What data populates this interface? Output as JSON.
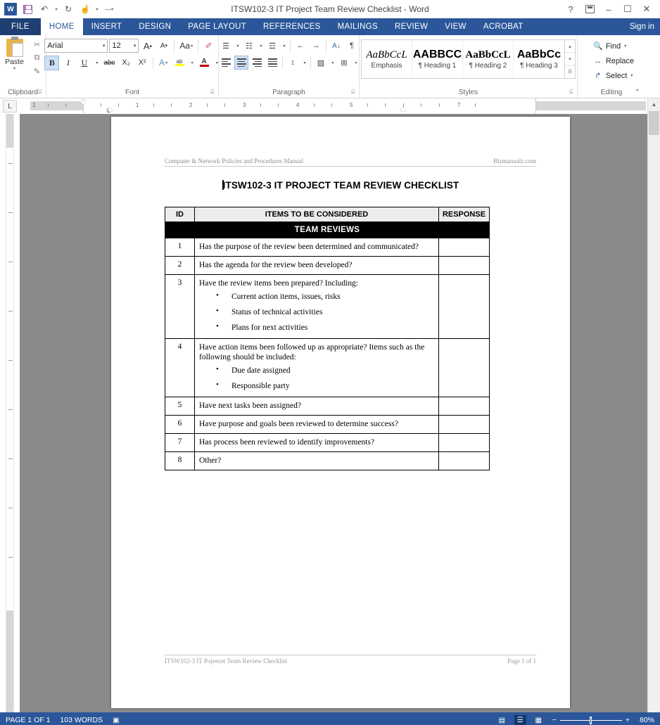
{
  "titlebar": {
    "app_icon": "word-logo",
    "document_title": "ITSW102-3 IT Project Team Review Checklist - Word",
    "quick_access": [
      {
        "name": "save",
        "glyph": "save-icon"
      },
      {
        "name": "undo",
        "glyph": "↶"
      },
      {
        "name": "redo",
        "glyph": "↻"
      },
      {
        "name": "touch-mode",
        "glyph": "☝"
      },
      {
        "name": "customize-qat",
        "glyph": "¯"
      }
    ],
    "help_label": "?",
    "ribbon_display_label": "",
    "minimize_label": "–",
    "maximize_label": "☐",
    "close_label": "✕",
    "word_mark": "W"
  },
  "tabs": {
    "file_label": "FILE",
    "items": [
      {
        "label": "HOME",
        "active": true
      },
      {
        "label": "INSERT",
        "active": false
      },
      {
        "label": "DESIGN",
        "active": false
      },
      {
        "label": "PAGE LAYOUT",
        "active": false
      },
      {
        "label": "REFERENCES",
        "active": false
      },
      {
        "label": "MAILINGS",
        "active": false
      },
      {
        "label": "REVIEW",
        "active": false
      },
      {
        "label": "VIEW",
        "active": false
      },
      {
        "label": "ACROBAT",
        "active": false
      }
    ],
    "signin_label": "Sign in"
  },
  "ribbon": {
    "clipboard": {
      "group_label": "Clipboard",
      "paste_label": "Paste",
      "paste_caret": "▾",
      "cut_label": "✂",
      "copy_label": "⧉",
      "format_painter_label": "✎"
    },
    "font": {
      "group_label": "Font",
      "font_name": "Arial",
      "font_size": "12",
      "grow_font": "A",
      "shrink_font": "A",
      "change_case": "Aa",
      "clear_formatting": "✐",
      "bold": "B",
      "italic": "I",
      "underline": "U",
      "strikethrough": "abc",
      "subscript": "X₂",
      "superscript": "X²",
      "text_effects": "A",
      "highlight": "ab",
      "font_color": "A",
      "font_color_hex": "#c00000",
      "highlight_color_hex": "#ffff00",
      "bold_active": true
    },
    "paragraph": {
      "group_label": "Paragraph",
      "bullets": "☰",
      "numbering": "☷",
      "multilevel": "☲",
      "decrease_indent": "←",
      "increase_indent": "→",
      "sort": "A↓",
      "show_marks": "¶",
      "align_left": "align-left",
      "align_center": "align-center",
      "align_right": "align-right",
      "justify": "justify",
      "line_spacing": "↕",
      "shading": "▧",
      "borders": "⊞",
      "center_active": true
    },
    "styles": {
      "group_label": "Styles",
      "items": [
        {
          "preview": "AaBbCcL",
          "name": "Emphasis",
          "mark": ""
        },
        {
          "preview": "AABBCC",
          "name": "Heading 1",
          "mark": "¶"
        },
        {
          "preview": "AaBbCcL",
          "name": "Heading 2",
          "mark": "¶"
        },
        {
          "preview": "AaBbCc",
          "name": "Heading 3",
          "mark": "¶"
        }
      ],
      "scroll_up": "▴",
      "scroll_down": "▾",
      "more": "☰"
    },
    "editing": {
      "group_label": "Editing",
      "find_label": "Find",
      "find_caret": "▾",
      "replace_label": "Replace",
      "select_label": "Select",
      "select_caret": "▾",
      "find_icon": "🔍",
      "replace_icon": "↔",
      "select_icon": "↱",
      "collapse_icon": "⌃"
    },
    "dialog_launcher": "⌸"
  },
  "ruler": {
    "tab_selector": "L",
    "horizontal_marks": [
      "1",
      "2",
      "3",
      "4",
      "5",
      "7"
    ],
    "unit": "inch"
  },
  "document": {
    "header_left": "Computer & Network Policies and Procedures Manual",
    "header_right": "Bizmanualz.com",
    "title": "ITSW102-3   IT PROJECT TEAM REVIEW CHECKLIST",
    "footer_left": "ITSW102-3 IT Pojeecet Team Review Checklist",
    "footer_right": "Page 1 of 1",
    "table": {
      "columns": [
        "ID",
        "ITEMS TO BE CONSIDERED",
        "RESPONSE"
      ],
      "section_band": "TEAM REVIEWS",
      "rows": [
        {
          "id": "1",
          "text": "Has the purpose of the review been determined and communicated?",
          "bullets": [],
          "response": ""
        },
        {
          "id": "2",
          "text": "Has the agenda for the review been developed?",
          "bullets": [],
          "response": ""
        },
        {
          "id": "3",
          "text": "Have the review items been prepared?  Including:",
          "bullets": [
            "Current action items, issues, risks",
            "Status of technical activities",
            "Plans for next activities"
          ],
          "response": ""
        },
        {
          "id": "4",
          "text": "Have action items been followed up as appropriate? Items such as the following should be included:",
          "bullets": [
            "Due date assigned",
            "Responsible party"
          ],
          "response": ""
        },
        {
          "id": "5",
          "text": "Have next tasks been assigned?",
          "bullets": [],
          "response": ""
        },
        {
          "id": "6",
          "text": "Have purpose and goals been reviewed to determine success?",
          "bullets": [],
          "response": ""
        },
        {
          "id": "7",
          "text": "Has process been reviewed to identify improvements?",
          "bullets": [],
          "response": ""
        },
        {
          "id": "8",
          "text": "Other?",
          "bullets": [],
          "response": ""
        }
      ]
    }
  },
  "statusbar": {
    "page_info": "PAGE 1 OF 1",
    "word_count": "103 WORDS",
    "proofing_icon": "▣",
    "view_read": "▤",
    "view_print": "☰",
    "view_web": "▦",
    "zoom_out": "−",
    "zoom_in": "+",
    "zoom_level": "80%"
  },
  "colors": {
    "accent": "#2b579a",
    "file_tab": "#1e3f73",
    "canvas": "#8a8a8a",
    "band": "#000000",
    "header_fill": "#ececec"
  }
}
